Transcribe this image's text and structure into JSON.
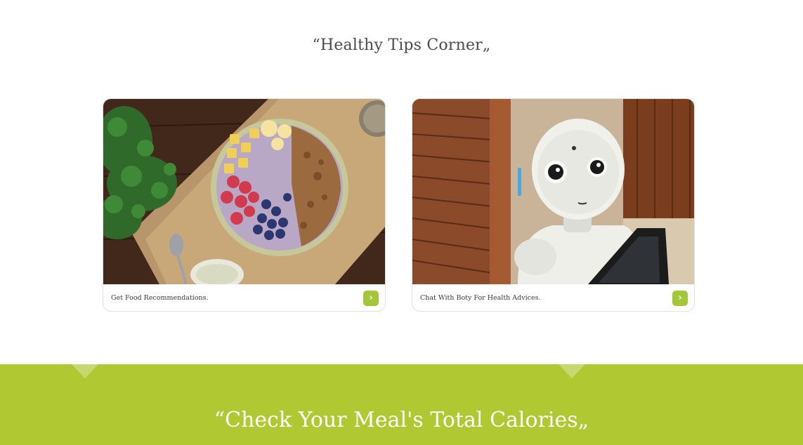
{
  "tips": {
    "title": "“Healthy Tips Corner„"
  },
  "cards": [
    {
      "label": "Get Food Recommendations.",
      "image": "acai-bowl-photo",
      "button_icon": "chevron-right-icon"
    },
    {
      "label": "Chat With Boty For Health Advices.",
      "image": "robot-photo",
      "button_icon": "chevron-right-icon"
    }
  ],
  "calories": {
    "title": "“Check Your Meal's Total Calories„"
  },
  "colors": {
    "accent": "#a4c639",
    "band": "#b0c832",
    "text": "#4a4a4a"
  }
}
